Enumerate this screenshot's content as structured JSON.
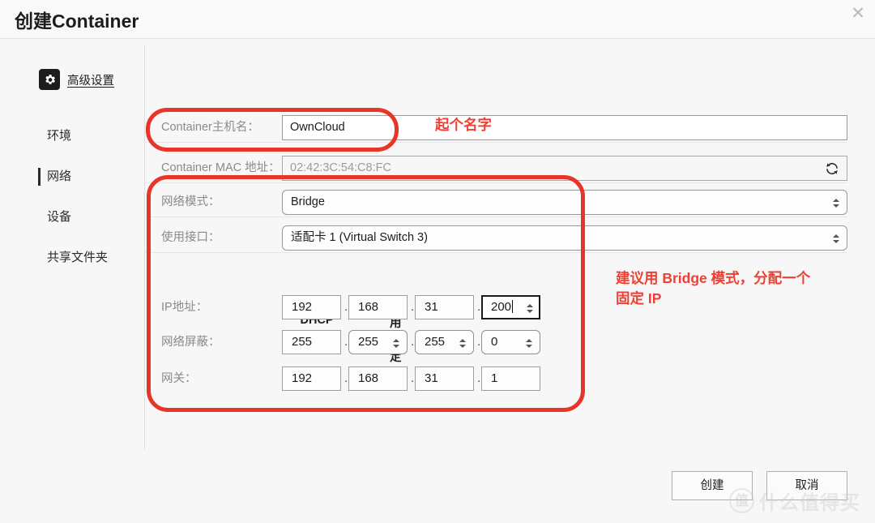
{
  "window": {
    "title": "创建Container",
    "close_icon": "close-icon"
  },
  "sidebar": {
    "advanced": {
      "label": "高级设置",
      "icon": "gear-icon"
    },
    "items": [
      {
        "label": "环境",
        "active": false
      },
      {
        "label": "网络",
        "active": true
      },
      {
        "label": "设备",
        "active": false
      },
      {
        "label": "共享文件夹",
        "active": false
      }
    ]
  },
  "form": {
    "hostname": {
      "label": "Container主机名：",
      "value": "OwnCloud"
    },
    "mac": {
      "label": "Container MAC 地址：",
      "value": "02:42:3C:54:C8:FC",
      "refresh_icon": "refresh-icon"
    },
    "network_mode": {
      "label": "网络模式：",
      "value": "Bridge"
    },
    "interface": {
      "label": "使用接口：",
      "value": "适配卡 1 (Virtual Switch 3)"
    },
    "ip_mode": {
      "dhcp_label": "使用DHCP",
      "static_label": "使用固定IP",
      "selected": "static"
    },
    "ip_address": {
      "label": "IP地址：",
      "octets": [
        "192",
        "168",
        "31",
        "200"
      ],
      "focused_index": 3
    },
    "netmask": {
      "label": "网络屏蔽：",
      "octets": [
        "255",
        "255",
        "255",
        "0"
      ]
    },
    "gateway": {
      "label": "网关：",
      "octets": [
        "192",
        "168",
        "31",
        "1"
      ]
    },
    "separator": "."
  },
  "annotations": {
    "accent_color": "#e8352a",
    "note_hostname": "起个名字",
    "note_network": "建议用 Bridge 模式，分配一个\n固定 IP"
  },
  "footer": {
    "create_label": "创建",
    "cancel_label": "取消"
  },
  "watermark": {
    "logo": "值",
    "text": "什么值得买"
  }
}
